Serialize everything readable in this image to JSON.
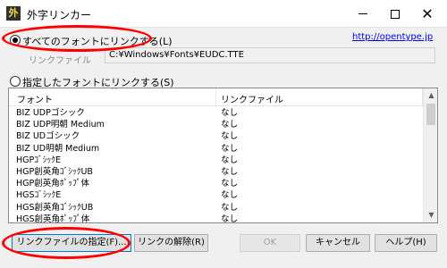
{
  "window": {
    "icon_char": "外",
    "title": "外字リンカー"
  },
  "options": {
    "all_fonts_label": "すべてのフォントにリンクする(L)",
    "all_fonts_checked": true,
    "specific_fonts_label": "指定したフォントにリンクする(S)",
    "specific_fonts_checked": false,
    "link_url": "http://opentype.jp"
  },
  "link_file": {
    "label": "リンクファイル",
    "value": "C:¥Windows¥Fonts¥EUDC.TTE"
  },
  "table": {
    "headers": [
      "フォント",
      "リンクファイル"
    ],
    "sort_arrow": "^",
    "rows": [
      {
        "font": "BIZ UDPゴシック",
        "file": "なし"
      },
      {
        "font": "BIZ UDP明朝 Medium",
        "file": "なし"
      },
      {
        "font": "BIZ UDゴシック",
        "file": "なし"
      },
      {
        "font": "BIZ UD明朝 Medium",
        "file": "なし"
      },
      {
        "font": "HGPｺﾞｼｯｸE",
        "file": "なし"
      },
      {
        "font": "HGP創英角ｺﾞｼｯｸUB",
        "file": "なし"
      },
      {
        "font": "HGP創英角ﾎﾟｯﾌﾟ体",
        "file": "なし"
      },
      {
        "font": "HGSｺﾞｼｯｸE",
        "file": "なし"
      },
      {
        "font": "HGS創英角ｺﾞｼｯｸUB",
        "file": "なし"
      },
      {
        "font": "HGS創英角ﾎﾟｯﾌﾟ体",
        "file": "なし"
      }
    ],
    "scroll_up": "▲",
    "scroll_down": "▼"
  },
  "buttons": {
    "specify_link_file": "リンクファイルの指定(F)...",
    "remove_link": "リンクの解除(R)",
    "ok": "OK",
    "cancel": "キャンセル",
    "help": "ヘルプ(H)"
  },
  "titlebar_buttons": {
    "close": "✕"
  },
  "colors": {
    "highlight_ellipse": "#ff0000",
    "link": "#0000ee"
  }
}
